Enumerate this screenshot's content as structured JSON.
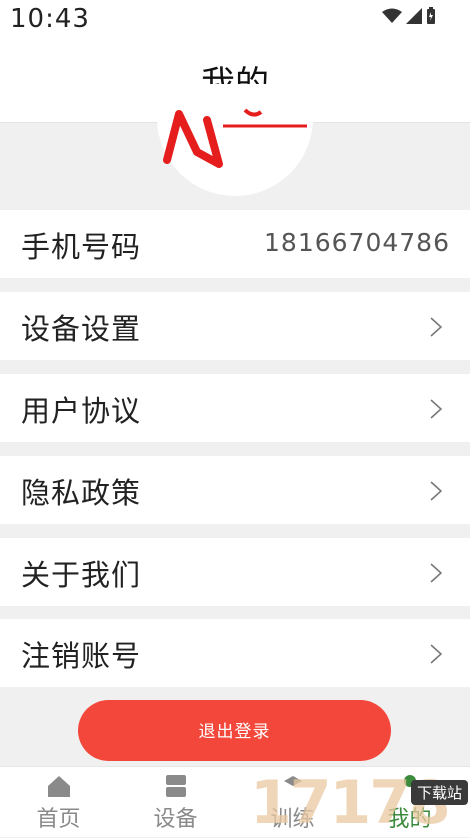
{
  "status_bar": {
    "time": "10:43"
  },
  "header": {
    "title": "我的"
  },
  "profile": {
    "avatar_alt": "avatar"
  },
  "rows": [
    {
      "label": "手机号码",
      "value": "18166704786"
    },
    {
      "label": "设备设置"
    },
    {
      "label": "用户协议"
    },
    {
      "label": "隐私政策"
    },
    {
      "label": "关于我们"
    },
    {
      "label": "注销账号"
    }
  ],
  "logout": {
    "label": "退出登录"
  },
  "tabs": [
    {
      "label": "首页",
      "icon": "home-icon"
    },
    {
      "label": "设备",
      "icon": "device-icon"
    },
    {
      "label": "训练",
      "icon": "training-icon"
    },
    {
      "label": "我的",
      "icon": "profile-icon",
      "active": true
    }
  ],
  "watermark": {
    "number": "17178",
    "badge": "下载站"
  },
  "colors": {
    "accent_red": "#f2473a",
    "active_tab": "#3c8a3c"
  }
}
